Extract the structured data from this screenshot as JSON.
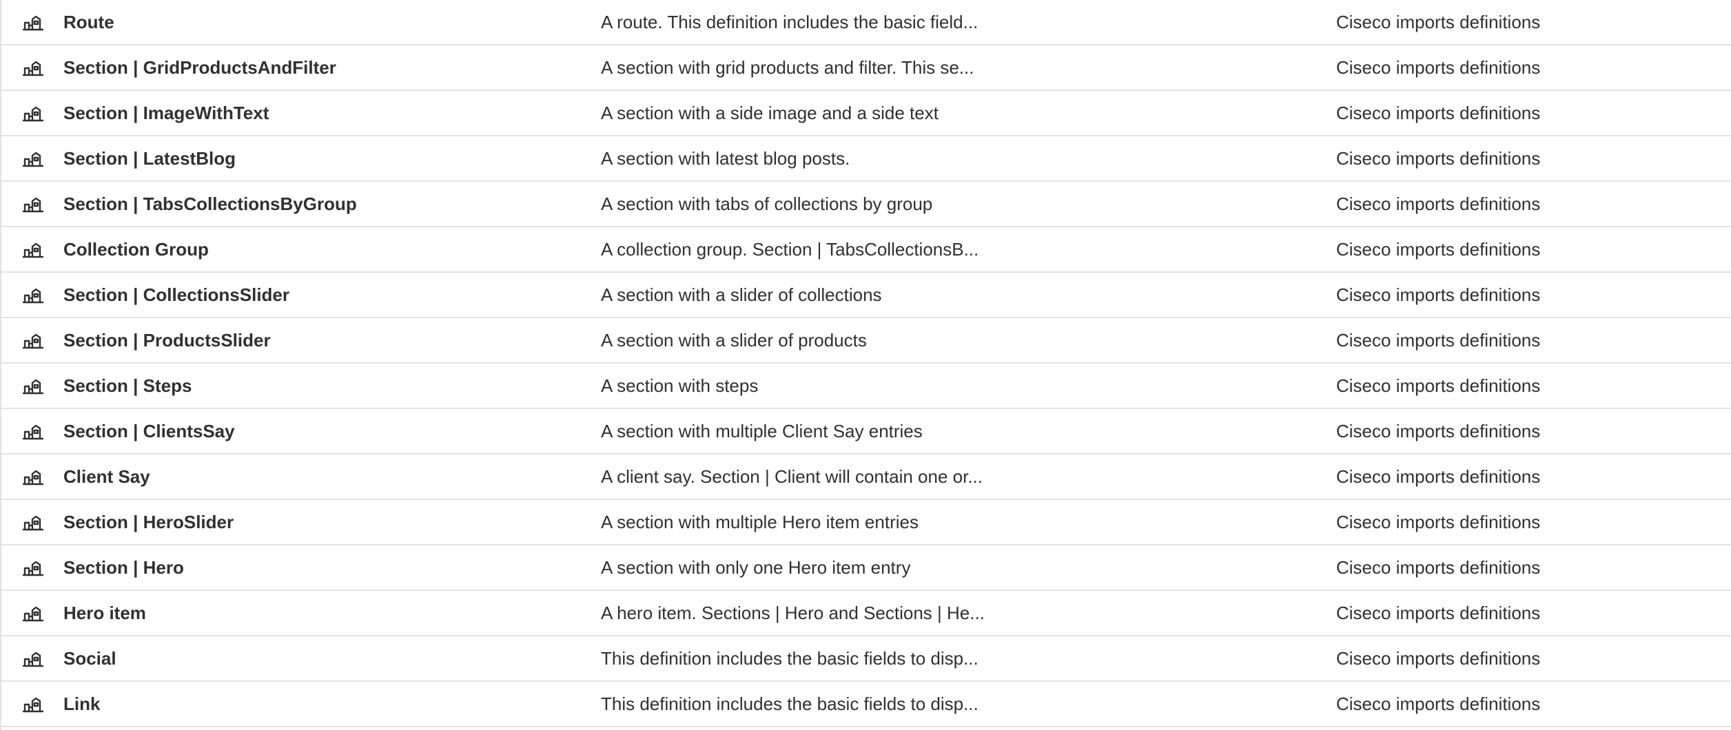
{
  "definitions": {
    "icon": "metaobject-icon",
    "rows": [
      {
        "name": "Route",
        "description": "A route. This definition includes the basic field...",
        "owner": "Ciseco imports definitions"
      },
      {
        "name": "Section | GridProductsAndFilter",
        "description": "A section with grid products and filter. This se...",
        "owner": "Ciseco imports definitions"
      },
      {
        "name": "Section | ImageWithText",
        "description": "A section with a side image and a side text",
        "owner": "Ciseco imports definitions"
      },
      {
        "name": "Section | LatestBlog",
        "description": "A section with latest blog posts.",
        "owner": "Ciseco imports definitions"
      },
      {
        "name": "Section | TabsCollectionsByGroup",
        "description": "A section with tabs of collections by group",
        "owner": "Ciseco imports definitions"
      },
      {
        "name": "Collection Group",
        "description": "A collection group. Section | TabsCollectionsB...",
        "owner": "Ciseco imports definitions"
      },
      {
        "name": "Section | CollectionsSlider",
        "description": "A section with a slider of collections",
        "owner": "Ciseco imports definitions"
      },
      {
        "name": "Section | ProductsSlider",
        "description": "A section with a slider of products",
        "owner": "Ciseco imports definitions"
      },
      {
        "name": "Section | Steps",
        "description": "A section with steps",
        "owner": "Ciseco imports definitions"
      },
      {
        "name": "Section | ClientsSay",
        "description": "A section with multiple Client Say entries",
        "owner": "Ciseco imports definitions"
      },
      {
        "name": "Client Say",
        "description": "A client say. Section | Client will contain one or...",
        "owner": "Ciseco imports definitions"
      },
      {
        "name": "Section | HeroSlider",
        "description": "A section with multiple Hero item entries",
        "owner": "Ciseco imports definitions"
      },
      {
        "name": "Section | Hero",
        "description": "A section with only one Hero item entry",
        "owner": "Ciseco imports definitions"
      },
      {
        "name": "Hero item",
        "description": "A hero item. Sections | Hero and Sections | He...",
        "owner": "Ciseco imports definitions"
      },
      {
        "name": "Social",
        "description": "This definition includes the basic fields to disp...",
        "owner": "Ciseco imports definitions"
      },
      {
        "name": "Link",
        "description": "This definition includes the basic fields to disp...",
        "owner": "Ciseco imports definitions"
      }
    ]
  }
}
